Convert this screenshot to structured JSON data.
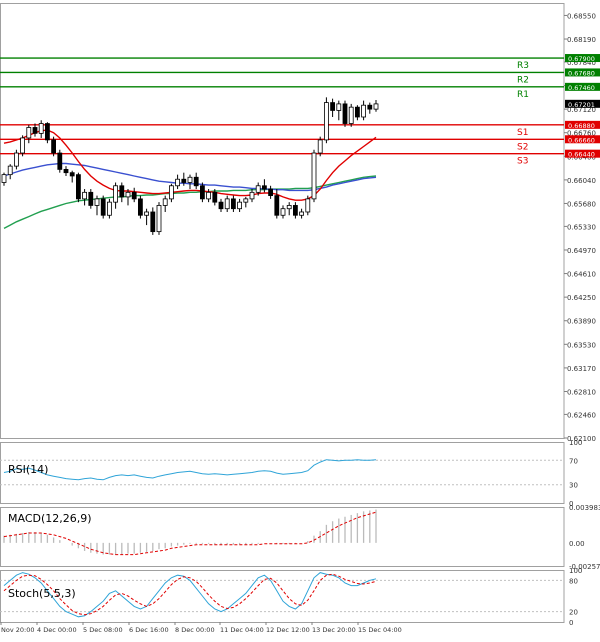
{
  "chart_data": {
    "type": "candlestick",
    "main_panel": {
      "price_ticks": [
        "0.68550",
        "0.68190",
        "0.67840",
        "0.67480",
        "0.67120",
        "0.66760",
        "0.66400",
        "0.66040",
        "0.65680",
        "0.65330",
        "0.64970",
        "0.64610",
        "0.64250",
        "0.63890",
        "0.63530",
        "0.63170",
        "0.62810",
        "0.62460",
        "0.62100"
      ],
      "price_range": [
        0.621,
        0.6874
      ],
      "levels": [
        {
          "name": "R3",
          "value": 0.679,
          "label": "0.67900",
          "color": "#008000"
        },
        {
          "name": "R2",
          "value": 0.6768,
          "label": "0.67680",
          "color": "#008000"
        },
        {
          "name": "R1",
          "value": 0.6746,
          "label": "0.67460",
          "color": "#008000"
        },
        {
          "name": "S1",
          "value": 0.6688,
          "label": "0.66880",
          "color": "#e00000"
        },
        {
          "name": "S2",
          "value": 0.6666,
          "label": "0.66660",
          "color": "#e00000"
        },
        {
          "name": "S3",
          "value": 0.6644,
          "label": "0.66440",
          "color": "#e00000"
        }
      ],
      "current_price": "0.67201",
      "candles": [
        [
          0.66,
          0.6615,
          0.6595,
          0.6612
        ],
        [
          0.6612,
          0.6628,
          0.6605,
          0.6625
        ],
        [
          0.6625,
          0.665,
          0.662,
          0.6645
        ],
        [
          0.6645,
          0.6672,
          0.664,
          0.6668
        ],
        [
          0.6668,
          0.6688,
          0.666,
          0.6684
        ],
        [
          0.6684,
          0.669,
          0.667,
          0.6675
        ],
        [
          0.6675,
          0.6695,
          0.6668,
          0.669
        ],
        [
          0.669,
          0.6692,
          0.666,
          0.6665
        ],
        [
          0.6665,
          0.667,
          0.664,
          0.6645
        ],
        [
          0.6645,
          0.665,
          0.6615,
          0.662
        ],
        [
          0.662,
          0.6625,
          0.661,
          0.6615
        ],
        [
          0.6615,
          0.6618,
          0.66,
          0.661
        ],
        [
          0.6612,
          0.6615,
          0.657,
          0.6575
        ],
        [
          0.6575,
          0.659,
          0.6565,
          0.6585
        ],
        [
          0.6585,
          0.659,
          0.656,
          0.6565
        ],
        [
          0.6565,
          0.658,
          0.655,
          0.6575
        ],
        [
          0.6575,
          0.658,
          0.6545,
          0.655
        ],
        [
          0.655,
          0.6575,
          0.6545,
          0.657
        ],
        [
          0.657,
          0.66,
          0.656,
          0.6595
        ],
        [
          0.6595,
          0.66,
          0.657,
          0.6578
        ],
        [
          0.6578,
          0.659,
          0.6565,
          0.6585
        ],
        [
          0.6585,
          0.6592,
          0.657,
          0.6575
        ],
        [
          0.6575,
          0.658,
          0.6545,
          0.655
        ],
        [
          0.655,
          0.656,
          0.6535,
          0.6555
        ],
        [
          0.6555,
          0.6562,
          0.652,
          0.6525
        ],
        [
          0.6525,
          0.657,
          0.652,
          0.6565
        ],
        [
          0.6565,
          0.658,
          0.6555,
          0.6575
        ],
        [
          0.6575,
          0.6598,
          0.657,
          0.6595
        ],
        [
          0.6595,
          0.6612,
          0.659,
          0.6605
        ],
        [
          0.6605,
          0.6615,
          0.6595,
          0.66
        ],
        [
          0.66,
          0.6612,
          0.659,
          0.6608
        ],
        [
          0.6608,
          0.6615,
          0.659,
          0.6595
        ],
        [
          0.6595,
          0.66,
          0.657,
          0.6575
        ],
        [
          0.6575,
          0.659,
          0.657,
          0.6585
        ],
        [
          0.6585,
          0.659,
          0.6565,
          0.657
        ],
        [
          0.657,
          0.6575,
          0.6555,
          0.656
        ],
        [
          0.656,
          0.658,
          0.6555,
          0.6575
        ],
        [
          0.6575,
          0.658,
          0.6555,
          0.656
        ],
        [
          0.656,
          0.6575,
          0.6555,
          0.657
        ],
        [
          0.657,
          0.6578,
          0.6562,
          0.6575
        ],
        [
          0.6575,
          0.659,
          0.657,
          0.6585
        ],
        [
          0.6585,
          0.66,
          0.658,
          0.6595
        ],
        [
          0.6595,
          0.6605,
          0.6585,
          0.659
        ],
        [
          0.659,
          0.6595,
          0.6575,
          0.658
        ],
        [
          0.658,
          0.659,
          0.6545,
          0.655
        ],
        [
          0.655,
          0.6565,
          0.6545,
          0.656
        ],
        [
          0.656,
          0.657,
          0.655,
          0.6565
        ],
        [
          0.6565,
          0.657,
          0.6545,
          0.655
        ],
        [
          0.655,
          0.656,
          0.6545,
          0.6555
        ],
        [
          0.6555,
          0.658,
          0.655,
          0.6575
        ],
        [
          0.6575,
          0.665,
          0.657,
          0.6645
        ],
        [
          0.6645,
          0.667,
          0.664,
          0.6665
        ],
        [
          0.6665,
          0.673,
          0.666,
          0.6722
        ],
        [
          0.6722,
          0.6728,
          0.67,
          0.671
        ],
        [
          0.671,
          0.6725,
          0.6695,
          0.672
        ],
        [
          0.672,
          0.6725,
          0.6685,
          0.669
        ],
        [
          0.669,
          0.672,
          0.6685,
          0.6715
        ],
        [
          0.6715,
          0.6718,
          0.6695,
          0.67
        ],
        [
          0.67,
          0.6725,
          0.6695,
          0.6718
        ],
        [
          0.6718,
          0.6722,
          0.6705,
          0.6712
        ],
        [
          0.6712,
          0.6726,
          0.6708,
          0.672
        ]
      ],
      "ma_fast_color": "#e00000",
      "ma_fast": [
        0.666,
        0.6662,
        0.6665,
        0.6668,
        0.6672,
        0.6676,
        0.6679,
        0.668,
        0.6676,
        0.6668,
        0.6657,
        0.6645,
        0.6632,
        0.662,
        0.661,
        0.6602,
        0.6596,
        0.6591,
        0.6588,
        0.6587,
        0.6587,
        0.6586,
        0.6585,
        0.6584,
        0.6583,
        0.6583,
        0.6584,
        0.6585,
        0.6586,
        0.6587,
        0.6588,
        0.6588,
        0.6587,
        0.6586,
        0.6585,
        0.6583,
        0.6582,
        0.6581,
        0.658,
        0.658,
        0.6581,
        0.6583,
        0.6584,
        0.6584,
        0.6582,
        0.6578,
        0.6575,
        0.6573,
        0.6573,
        0.6575,
        0.658,
        0.659,
        0.6603,
        0.6615,
        0.6625,
        0.6633,
        0.6641,
        0.6648,
        0.6655,
        0.6662,
        0.6669
      ],
      "ma_mid_color": "#3a50d0",
      "ma_mid": [
        0.661,
        0.6613,
        0.6616,
        0.6619,
        0.6621,
        0.6623,
        0.6625,
        0.6627,
        0.6628,
        0.6629,
        0.6629,
        0.6628,
        0.6627,
        0.6626,
        0.6624,
        0.6622,
        0.662,
        0.6618,
        0.6616,
        0.6614,
        0.6612,
        0.661,
        0.6608,
        0.6606,
        0.6604,
        0.6602,
        0.6601,
        0.66,
        0.6599,
        0.6599,
        0.6598,
        0.6598,
        0.6597,
        0.6596,
        0.6596,
        0.6595,
        0.6594,
        0.6593,
        0.6593,
        0.6592,
        0.6591,
        0.6591,
        0.659,
        0.659,
        0.6589,
        0.6589,
        0.6588,
        0.6588,
        0.6588,
        0.6588,
        0.6589,
        0.6591,
        0.6593,
        0.6596,
        0.6598,
        0.66,
        0.6602,
        0.6604,
        0.6606,
        0.6607,
        0.6608
      ],
      "ma_slow_color": "#22a050",
      "ma_slow": [
        0.653,
        0.6535,
        0.654,
        0.6544,
        0.6548,
        0.6552,
        0.6556,
        0.6559,
        0.6562,
        0.6565,
        0.6568,
        0.657,
        0.6572,
        0.6573,
        0.6574,
        0.6575,
        0.6576,
        0.6577,
        0.6578,
        0.6578,
        0.6579,
        0.658,
        0.658,
        0.6581,
        0.6581,
        0.6582,
        0.6583,
        0.6583,
        0.6584,
        0.6584,
        0.6585,
        0.6585,
        0.6586,
        0.6586,
        0.6587,
        0.6587,
        0.6587,
        0.6588,
        0.6588,
        0.6588,
        0.6589,
        0.6589,
        0.6589,
        0.659,
        0.659,
        0.659,
        0.659,
        0.6591,
        0.6591,
        0.6591,
        0.6592,
        0.6594,
        0.6596,
        0.6598,
        0.66,
        0.6602,
        0.6604,
        0.6606,
        0.6608,
        0.6609,
        0.661
      ]
    },
    "rsi_panel": {
      "label": "RSI(14)",
      "ticks": [
        "100",
        "70",
        "30",
        "0"
      ],
      "range": [
        0,
        100
      ],
      "color": "#2fa4d8",
      "values": [
        50,
        52,
        56,
        55,
        57,
        54,
        50,
        46,
        44,
        42,
        40,
        39,
        38,
        40,
        41,
        39,
        38,
        42,
        45,
        46,
        45,
        46,
        44,
        42,
        41,
        44,
        46,
        48,
        50,
        51,
        52,
        50,
        48,
        47,
        48,
        47,
        46,
        47,
        48,
        49,
        50,
        52,
        53,
        52,
        49,
        47,
        48,
        49,
        50,
        53,
        62,
        67,
        71,
        70,
        69,
        70,
        70,
        71,
        70,
        70,
        71
      ]
    },
    "macd_panel": {
      "label": "MACD(12,26,9)",
      "ticks": [
        "0.003983",
        "0.00",
        "-0.00257"
      ],
      "range": [
        -0.00257,
        0.003983
      ],
      "histogram_color": "#bbbbbb",
      "signal_color": "#e00000",
      "histogram": [
        0.0008,
        0.0009,
        0.001,
        0.0011,
        0.0012,
        0.0012,
        0.0011,
        0.0009,
        0.0006,
        0.0003,
        0.0,
        -0.0003,
        -0.0006,
        -0.0009,
        -0.0011,
        -0.0012,
        -0.0013,
        -0.0013,
        -0.0013,
        -0.0013,
        -0.0012,
        -0.0012,
        -0.0011,
        -0.001,
        -0.0009,
        -0.0007,
        -0.0006,
        -0.0004,
        -0.0003,
        -0.0002,
        -0.0001,
        -0.0001,
        -0.0001,
        -0.0001,
        -0.0002,
        -0.0002,
        -0.0002,
        -0.0002,
        -0.0002,
        -0.0002,
        -0.0001,
        -0.0001,
        0.0,
        0.0,
        -0.0001,
        -0.0001,
        -0.0001,
        -0.0001,
        0.0,
        0.0002,
        0.0008,
        0.0013,
        0.002,
        0.0024,
        0.0027,
        0.0029,
        0.0031,
        0.0033,
        0.0035,
        0.0036,
        0.0037
      ],
      "signal": [
        0.0007,
        0.0008,
        0.0009,
        0.001,
        0.0011,
        0.0011,
        0.0011,
        0.001,
        0.0009,
        0.0007,
        0.0005,
        0.0002,
        -0.0001,
        -0.0004,
        -0.0007,
        -0.0009,
        -0.0011,
        -0.0012,
        -0.0013,
        -0.0013,
        -0.0013,
        -0.0013,
        -0.0012,
        -0.0011,
        -0.001,
        -0.0009,
        -0.0008,
        -0.0006,
        -0.0005,
        -0.0004,
        -0.0003,
        -0.0002,
        -0.0002,
        -0.0002,
        -0.0002,
        -0.0002,
        -0.0002,
        -0.0002,
        -0.0002,
        -0.0002,
        -0.0002,
        -0.0002,
        -0.0001,
        -0.0001,
        -0.0001,
        -0.0001,
        -0.0001,
        -0.0001,
        -0.0001,
        0.0,
        0.0003,
        0.0007,
        0.0011,
        0.0015,
        0.0019,
        0.0022,
        0.0025,
        0.0028,
        0.003,
        0.0032,
        0.0034
      ]
    },
    "stoch_panel": {
      "label": "Stoch(5,5,3)",
      "ticks": [
        "100",
        "80",
        "20",
        "0"
      ],
      "range": [
        0,
        100
      ],
      "main_color": "#2fa4d8",
      "signal_color": "#e00000",
      "main": [
        70,
        80,
        90,
        95,
        92,
        85,
        75,
        60,
        45,
        30,
        20,
        15,
        10,
        12,
        20,
        30,
        40,
        55,
        60,
        50,
        40,
        30,
        25,
        30,
        45,
        60,
        75,
        85,
        90,
        88,
        80,
        65,
        50,
        35,
        25,
        20,
        25,
        35,
        45,
        55,
        70,
        85,
        90,
        80,
        60,
        40,
        30,
        25,
        35,
        60,
        85,
        95,
        92,
        90,
        85,
        75,
        70,
        70,
        75,
        80,
        83
      ],
      "signal": [
        60,
        70,
        80,
        88,
        90,
        89,
        82,
        72,
        60,
        45,
        33,
        22,
        16,
        14,
        16,
        22,
        30,
        42,
        52,
        55,
        50,
        42,
        35,
        30,
        35,
        45,
        58,
        72,
        82,
        87,
        85,
        78,
        66,
        52,
        40,
        30,
        26,
        28,
        35,
        45,
        57,
        70,
        82,
        84,
        75,
        60,
        45,
        35,
        32,
        42,
        60,
        80,
        90,
        92,
        88,
        82,
        78,
        74,
        73,
        75,
        78
      ]
    },
    "time_labels": [
      "Nov 20:00",
      "4 Dec 00:00",
      "5 Dec 08:00",
      "6 Dec 16:00",
      "8 Dec 00:00",
      "11 Dec 04:00",
      "12 Dec 12:00",
      "13 Dec 20:00",
      "15 Dec 04:00"
    ]
  }
}
